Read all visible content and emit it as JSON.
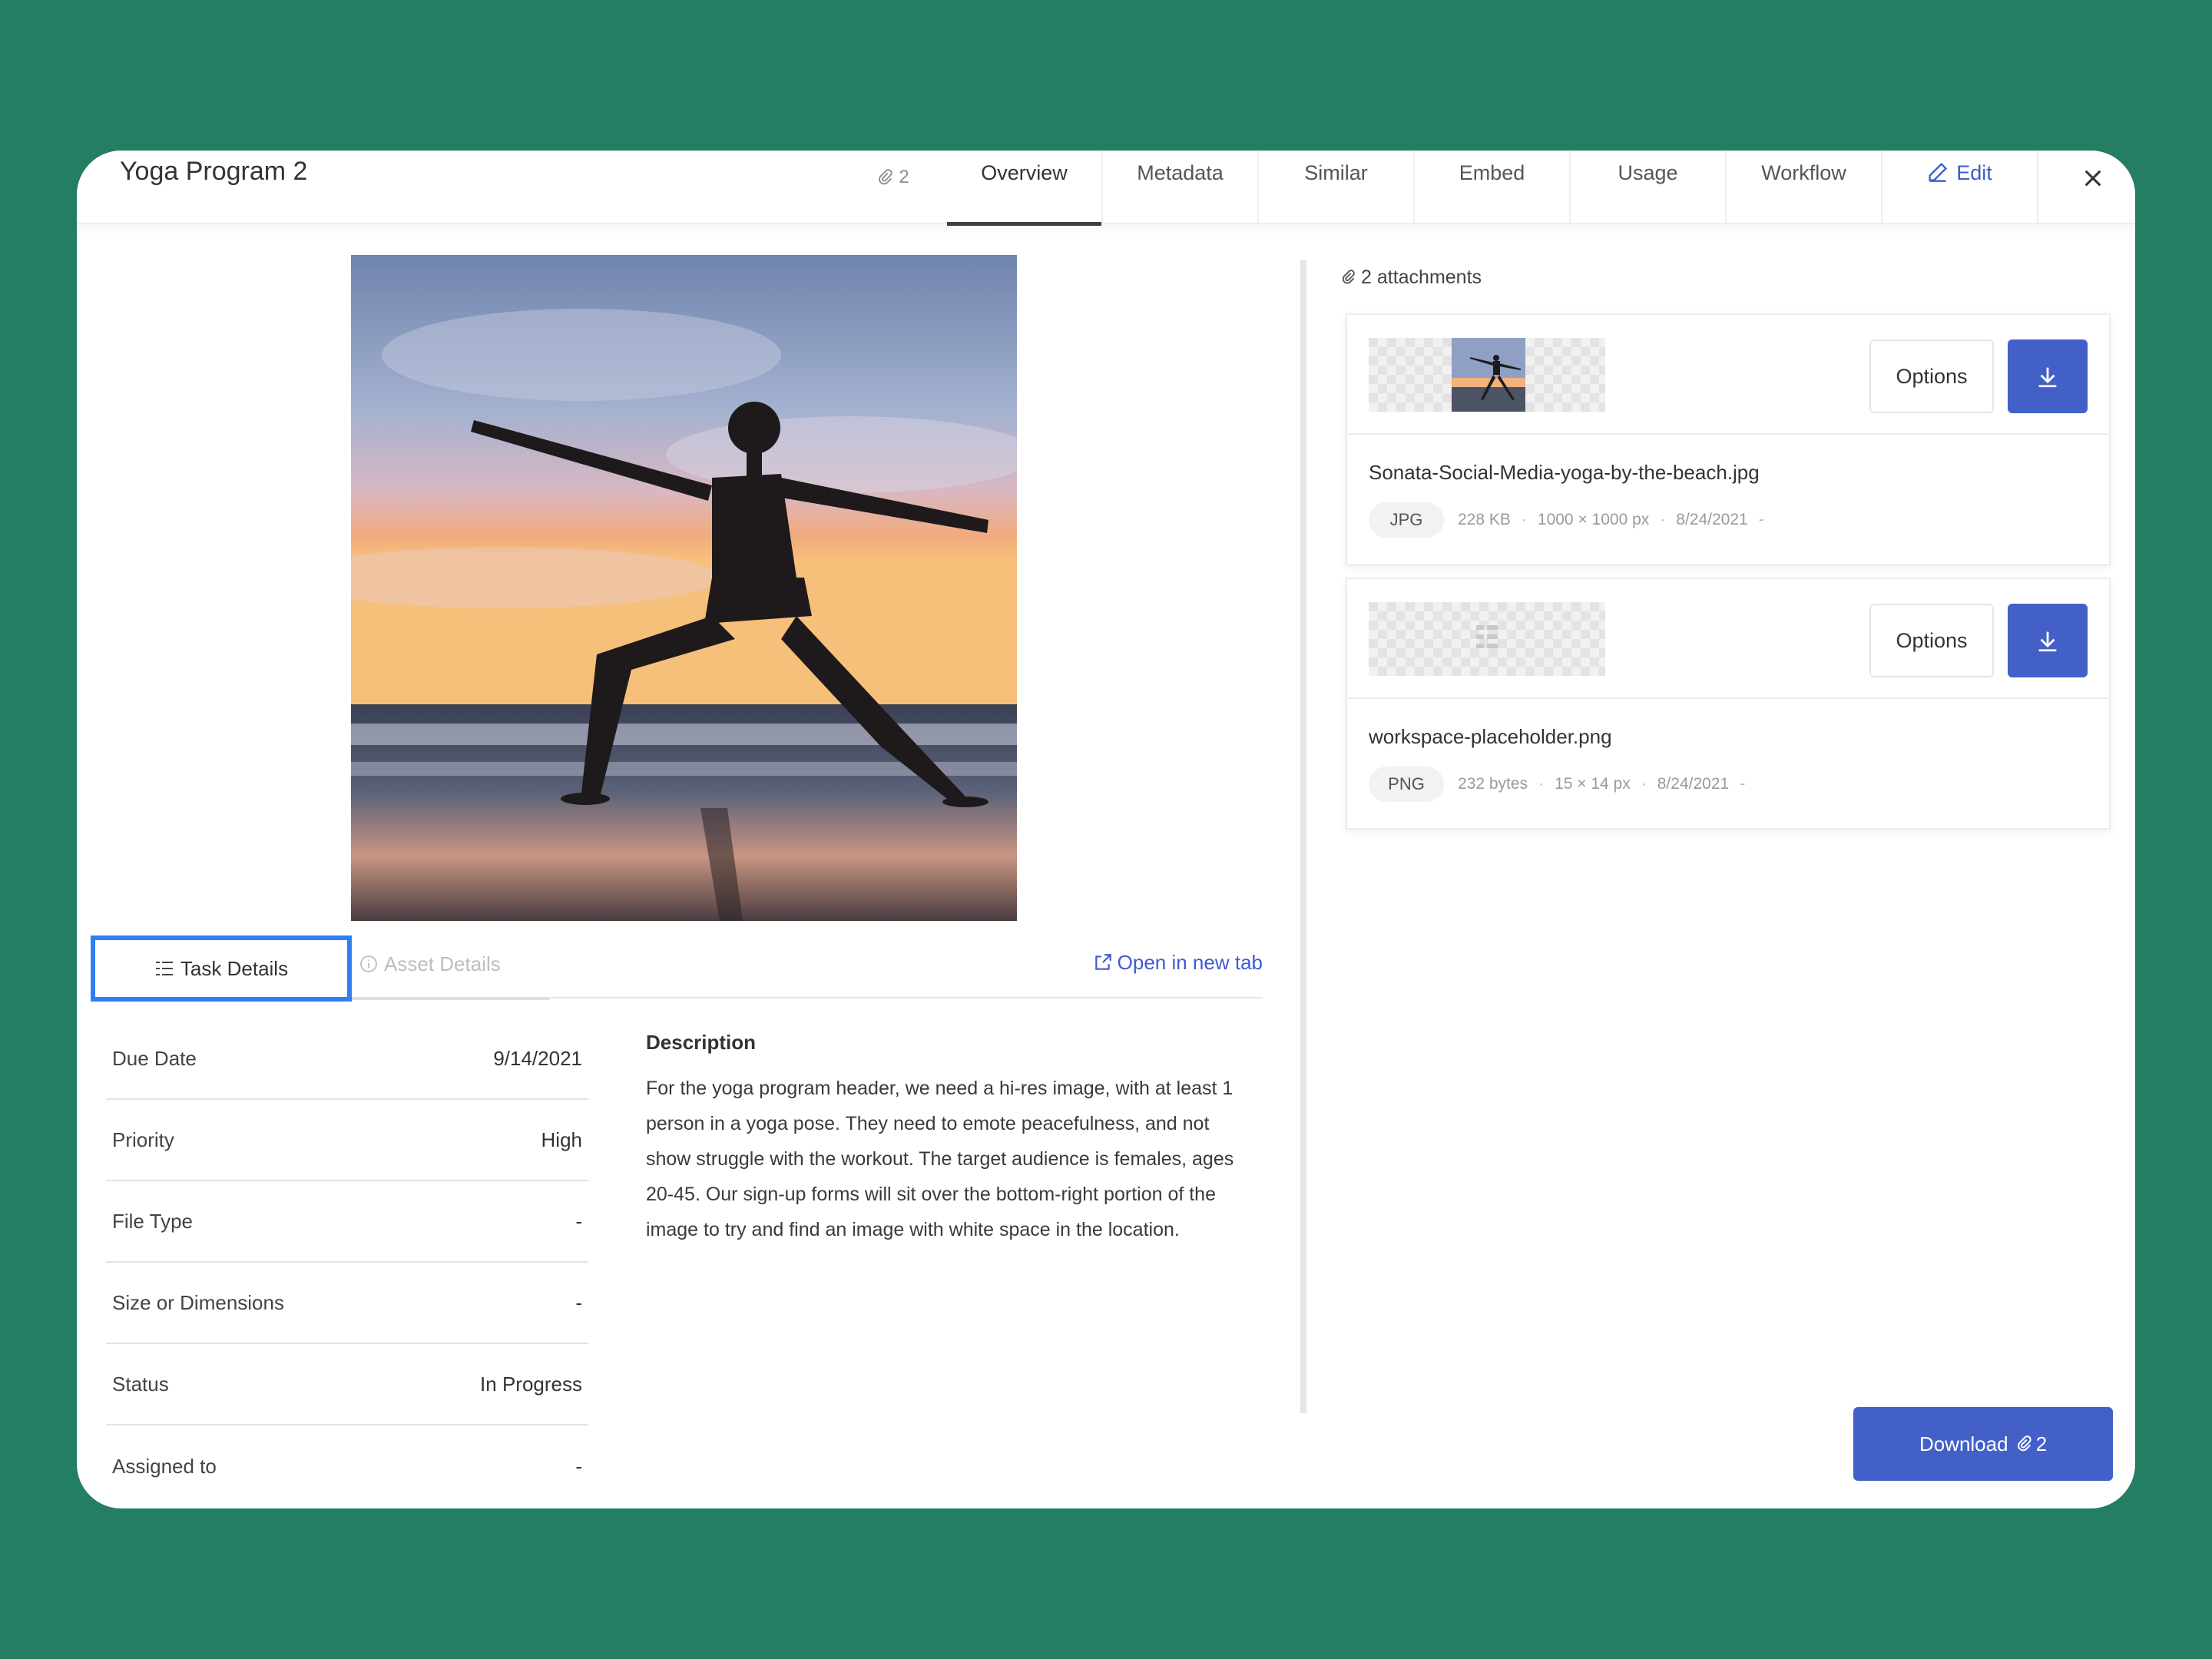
{
  "header": {
    "title": "Yoga Program 2",
    "attachment_count": "2",
    "tabs": [
      {
        "label": "Overview",
        "active": true
      },
      {
        "label": "Metadata"
      },
      {
        "label": "Similar"
      },
      {
        "label": "Embed"
      },
      {
        "label": "Usage"
      },
      {
        "label": "Workflow"
      }
    ],
    "edit_label": "Edit"
  },
  "detail_tabs": {
    "task_details": "Task Details",
    "asset_details": "Asset Details",
    "open_new_tab": "Open in new tab"
  },
  "fields": [
    {
      "label": "Due Date",
      "value": "9/14/2021"
    },
    {
      "label": "Priority",
      "value": "High"
    },
    {
      "label": "File Type",
      "value": "-"
    },
    {
      "label": "Size or Dimensions",
      "value": "-"
    },
    {
      "label": "Status",
      "value": "In Progress"
    },
    {
      "label": "Assigned to",
      "value": "-"
    }
  ],
  "description": {
    "title": "Description",
    "text": "For the yoga program header, we need a hi-res image, with at least 1 person in a yoga pose. They need to emote peacefulness, and not show struggle with the workout. The target audience is females, ages 20-45. Our sign-up forms will sit over the bottom-right portion of the image to try and find an image with white space in the location."
  },
  "attachments": {
    "header": "2 attachments",
    "items": [
      {
        "options_label": "Options",
        "file_name": "Sonata-Social-Media-yoga-by-the-beach.jpg",
        "type": "JPG",
        "size": "228 KB",
        "dimensions": "1000 × 1000 px",
        "date": "8/24/2021",
        "trailing": "-"
      },
      {
        "options_label": "Options",
        "file_name": "workspace-placeholder.png",
        "type": "PNG",
        "size": "232 bytes",
        "dimensions": "15 × 14 px",
        "date": "8/24/2021",
        "trailing": "-"
      }
    ]
  },
  "download_all": {
    "label": "Download",
    "count": "2"
  },
  "colors": {
    "background": "#247e63",
    "accent": "#4360c8",
    "link": "#3f5bd0",
    "focus": "#2f7ff4"
  }
}
